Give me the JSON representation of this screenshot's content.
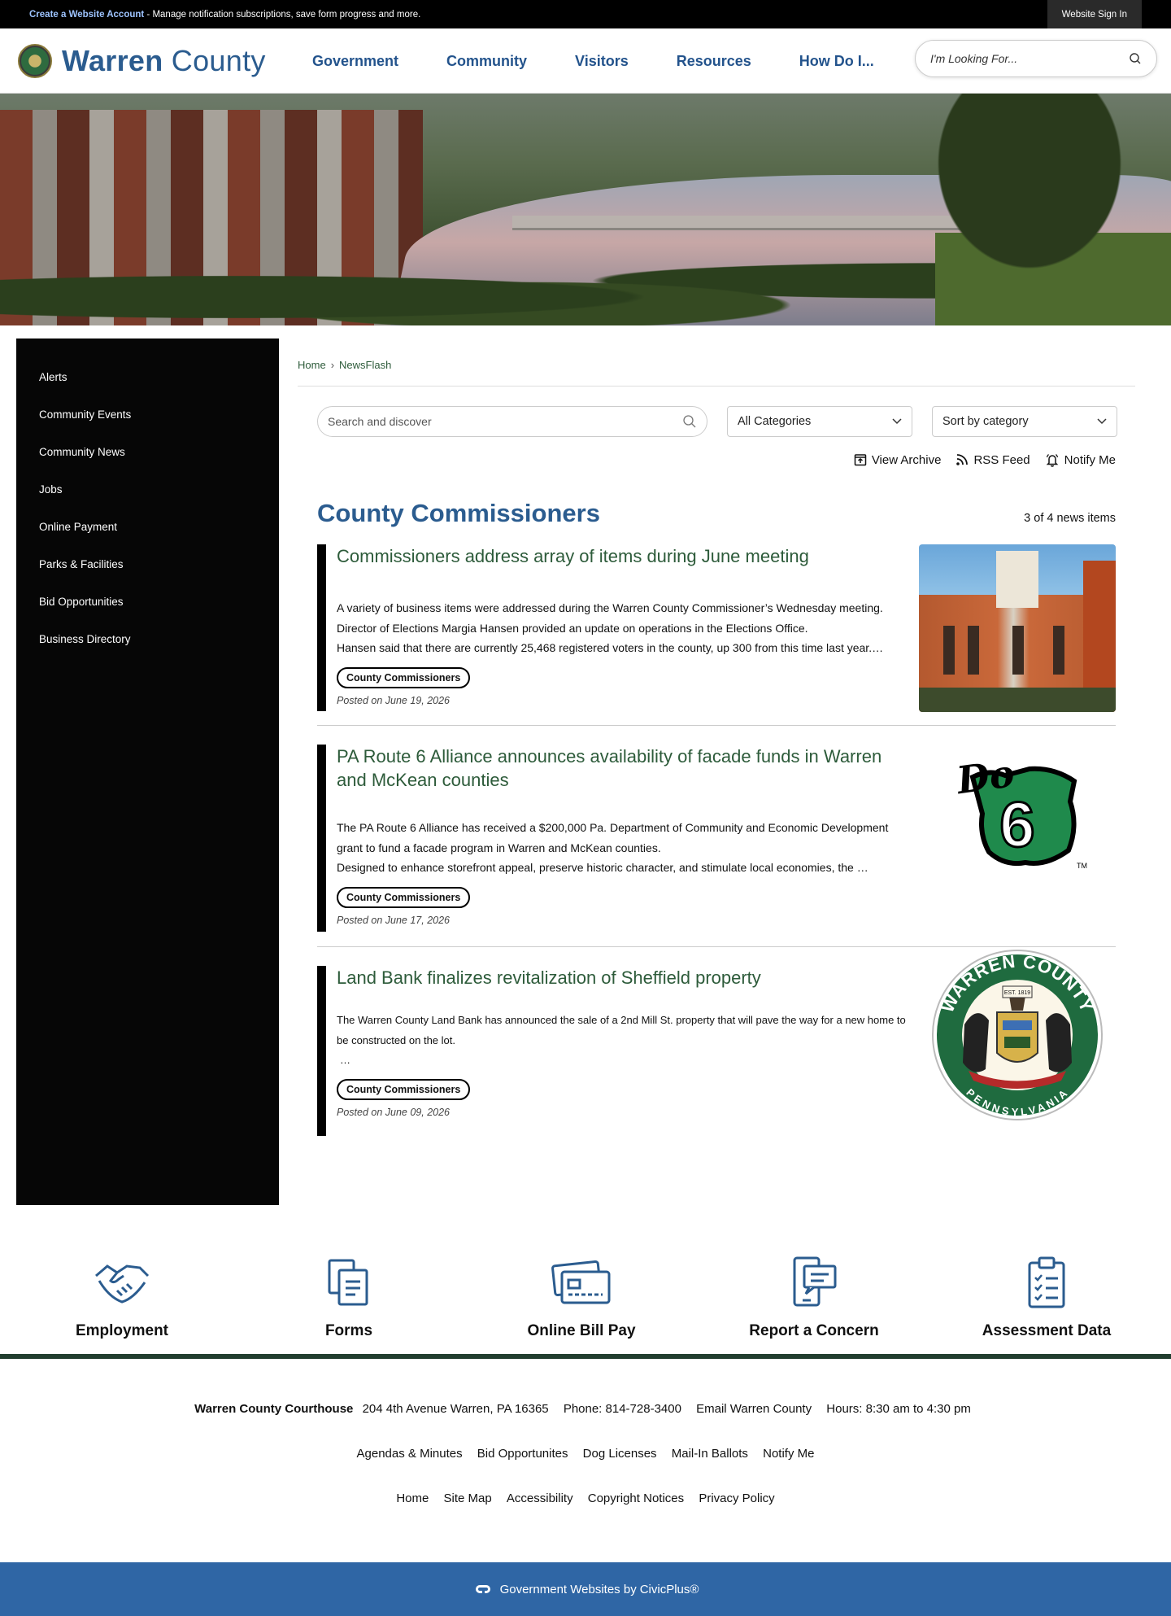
{
  "topbar": {
    "create_account": "Create a Website Account",
    "create_account_suffix": " - Manage notification subscriptions, save form progress and more.",
    "signin": "Website Sign In"
  },
  "header": {
    "logo_bold": "Warren",
    "logo_light": " County",
    "search_placeholder": "I'm Looking For..."
  },
  "nav": [
    {
      "label": "Government"
    },
    {
      "label": "Community"
    },
    {
      "label": "Visitors"
    },
    {
      "label": "Resources"
    },
    {
      "label": "How Do I..."
    }
  ],
  "sidebar": [
    {
      "label": "Alerts"
    },
    {
      "label": "Community Events"
    },
    {
      "label": "Community News"
    },
    {
      "label": "Jobs"
    },
    {
      "label": "Online Payment"
    },
    {
      "label": "Parks & Facilities"
    },
    {
      "label": "Bid Opportunities"
    },
    {
      "label": "Business Directory"
    }
  ],
  "breadcrumb": {
    "home": "Home",
    "sep": "›",
    "current": "NewsFlash"
  },
  "filters": {
    "search_placeholder": "Search and discover",
    "categories": "All Categories",
    "sort": "Sort by category"
  },
  "actions": {
    "archive": "View Archive",
    "rss": "RSS Feed",
    "notify": "Notify Me"
  },
  "category": {
    "title": "County Commissioners",
    "count": "3 of 4 news items"
  },
  "news": [
    {
      "title": "Commissioners address array of items during June meeting",
      "summary": [
        "A variety of business items were addressed during the Warren County Commissioner’s Wednesday meeting.",
        "Director of Elections Margia Hansen provided an update on operations in the Elections Office.",
        "Hansen said that there are currently 25,468 registered voters in the county, up 300 from this time last year.…"
      ],
      "tag": "County Commissioners",
      "posted": "Posted on June 19, 2026"
    },
    {
      "title": "PA Route 6 Alliance announces availability of facade funds in Warren and McKean counties",
      "summary": [
        "The PA Route 6 Alliance has received a $200,000 Pa. Department of Community and Economic Development grant to fund a facade program in Warren and McKean counties.",
        "Designed to enhance storefront appeal, preserve historic character, and stimulate local economies, the …"
      ],
      "tag": "County Commissioners",
      "posted": "Posted on June 17, 2026"
    },
    {
      "title": "Land Bank finalizes revitalization of Sheffield property",
      "summary": [
        "The Warren County Land Bank has announced the sale of a 2nd Mill St. property that will pave the way for a new home to be constructed on the lot.",
        "…"
      ],
      "tag": "County Commissioners",
      "posted": "Posted on June 09, 2026"
    }
  ],
  "images": {
    "do6_text": "Do",
    "do6_number": "6",
    "do6_tm": "TM",
    "seal_top": "WARREN COUNTY",
    "seal_est": "EST. 1819",
    "seal_bottom": "PENNSYLVANIA"
  },
  "quicklinks": [
    {
      "label": "Employment",
      "icon": "handshake-icon"
    },
    {
      "label": "Forms",
      "icon": "forms-icon"
    },
    {
      "label": "Online Bill Pay",
      "icon": "credit-card-icon"
    },
    {
      "label": "Report a Concern",
      "icon": "report-device-icon"
    },
    {
      "label": "Assessment Data",
      "icon": "clipboard-icon"
    }
  ],
  "footer": {
    "courthouse": "Warren County Courthouse",
    "address": "204 4th Avenue Warren, PA 16365",
    "phone": "Phone: 814-728-3400",
    "email": "Email Warren County",
    "hours": "Hours: 8:30 am to 4:30 pm",
    "links1": [
      "Agendas & Minutes",
      "Bid Opportunites",
      "Dog Licenses",
      "Mail-In Ballots",
      "Notify Me"
    ],
    "links2": [
      "Home",
      "Site Map",
      "Accessibility",
      "Copyright Notices",
      "Privacy Policy"
    ]
  },
  "civic": {
    "text": "Government Websites by",
    "link": "CivicPlus®"
  },
  "colors": {
    "brand_blue": "#2b5c8f",
    "green_text": "#2d5b3a",
    "footer_bar": "#2f66a5",
    "sidebar": "#060606"
  }
}
